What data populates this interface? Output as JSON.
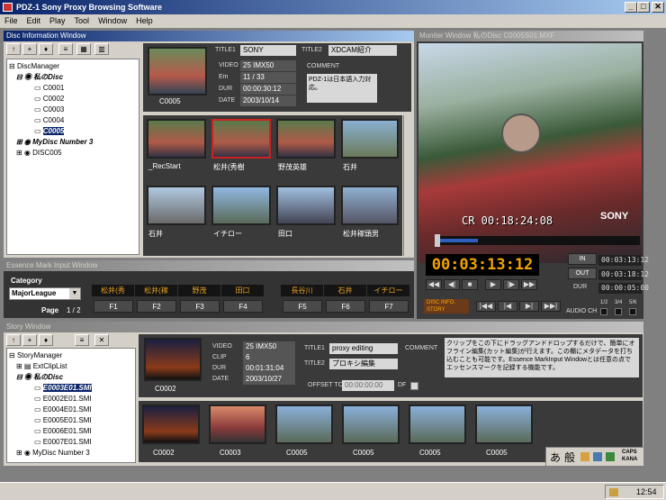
{
  "app": {
    "title": "PDZ-1  Sony Proxy Browsing Software",
    "min": "_",
    "max": "□",
    "close": "✕"
  },
  "menu": [
    "File",
    "Edit",
    "Play",
    "Tool",
    "Window",
    "Help"
  ],
  "disc_window": {
    "title": "Disc Information Window",
    "tree": {
      "root": "DiscManager",
      "disc1": "私のDisc",
      "clips": [
        "C0001",
        "C0002",
        "C0003",
        "C0004",
        "C0005"
      ],
      "disc2": "MyDisc Number 3",
      "disc3": "DISC005"
    },
    "toolbar": [
      "↑",
      "+",
      "♦",
      "≡",
      "▦",
      "▥"
    ],
    "clip": {
      "name": "C0005",
      "title1_label": "TITLE1",
      "title1": "SONY",
      "title2_label": "TITLE2",
      "title2": "XDCAM紹介",
      "comment_label": "COMMENT",
      "comment": "PDZ-1は日本語入力対応。",
      "video_label": "VIDEO",
      "video": "25 IMX50",
      "em_label": "Em",
      "em": "11 / 33",
      "dur_label": "DUR",
      "dur": "00:00:30:12",
      "date_label": "DATE",
      "date": "2003/10/14"
    },
    "thumbs": [
      "_RecStart",
      "松井(秀樹",
      "野茂英雄",
      "石井",
      "石井",
      "イチロー",
      "田口",
      "松井稼頭男"
    ]
  },
  "monitor": {
    "title": "Moniter Window  私のDisc C0005S01.MXF",
    "timecode_overlay": "CR 00:18:24:08",
    "brand": "SONY",
    "timecode": "00:03:13:12",
    "in_label": "IN",
    "in_tc": "00:03:13:12",
    "out_label": "OUT",
    "out_tc": "00:03:18:12",
    "dur_label": "DUR",
    "dur_tc": "00:00:05:00",
    "disc_info": "DISC INFO.",
    "story": "STORY",
    "audio_label": "AUDIO CH",
    "audio_channels": [
      "1/2",
      "3/4",
      "5/6"
    ],
    "transport": [
      "◀◀",
      "◀|",
      "■",
      "▶",
      "|▶",
      "▶▶"
    ],
    "nav": [
      "|◀◀",
      "|◀",
      "▶|",
      "▶▶|"
    ]
  },
  "essence": {
    "title": "Essence Mark Input Window",
    "category_label": "Category",
    "category_value": "MajorLeague",
    "page_label": "Page",
    "page": "1 / 2",
    "marks": [
      "松井(秀",
      "松井(稼",
      "野茂",
      "田口",
      "長谷川",
      "石井",
      "イチロー"
    ],
    "fkeys": [
      "F1",
      "F2",
      "F3",
      "F4",
      "F5",
      "F6",
      "F7"
    ]
  },
  "story": {
    "title": "Story Window",
    "tree": {
      "root": "StoryManager",
      "clip_list": "ExtClipList",
      "disc": "私のDisc",
      "items": [
        "E0003E01.SMI",
        "E0002E01.SMI",
        "E0004E01.SMI",
        "E0005E01.SMI",
        "E0006E01.SMI",
        "E0007E01.SMI"
      ],
      "disc2": "MyDisc Number 3"
    },
    "toolbar": [
      "↑",
      "+",
      "♦",
      "≡",
      "✕"
    ],
    "clip": {
      "name": "C0002",
      "video_label": "VIDEO",
      "video": "25 IMX50",
      "clip_label": "CLIP",
      "clip": "6",
      "dur_label": "DUR",
      "dur": "00:01:31:04",
      "date_label": "DATE",
      "date": "2003/10/27",
      "title1_label": "TITLE1",
      "title1": "proxy editing",
      "title2_label": "TITLE2",
      "title2": "プロキシ編集",
      "comment_label": "COMMENT",
      "comment": "クリップをこの下にドラッグアンドドロップするだけで、簡単にオフライン編集(カット編集)が行えます。この欄にメタデータを打ち込むことも可能です。Essence MarkInput Windowとは任意の点でエッセンスマークを記録する機能です。",
      "offset_label": "OFFSET TC",
      "offset": "00:00:00:00",
      "df_label": "DF"
    },
    "strip": [
      "C0002",
      "C0003",
      "C0005",
      "C0005",
      "C0005",
      "C0005"
    ]
  },
  "ime": {
    "items": [
      "あ",
      "般"
    ],
    "caps": "CAPS",
    "kana": "KANA"
  },
  "taskbar": {
    "time": "12:54"
  }
}
